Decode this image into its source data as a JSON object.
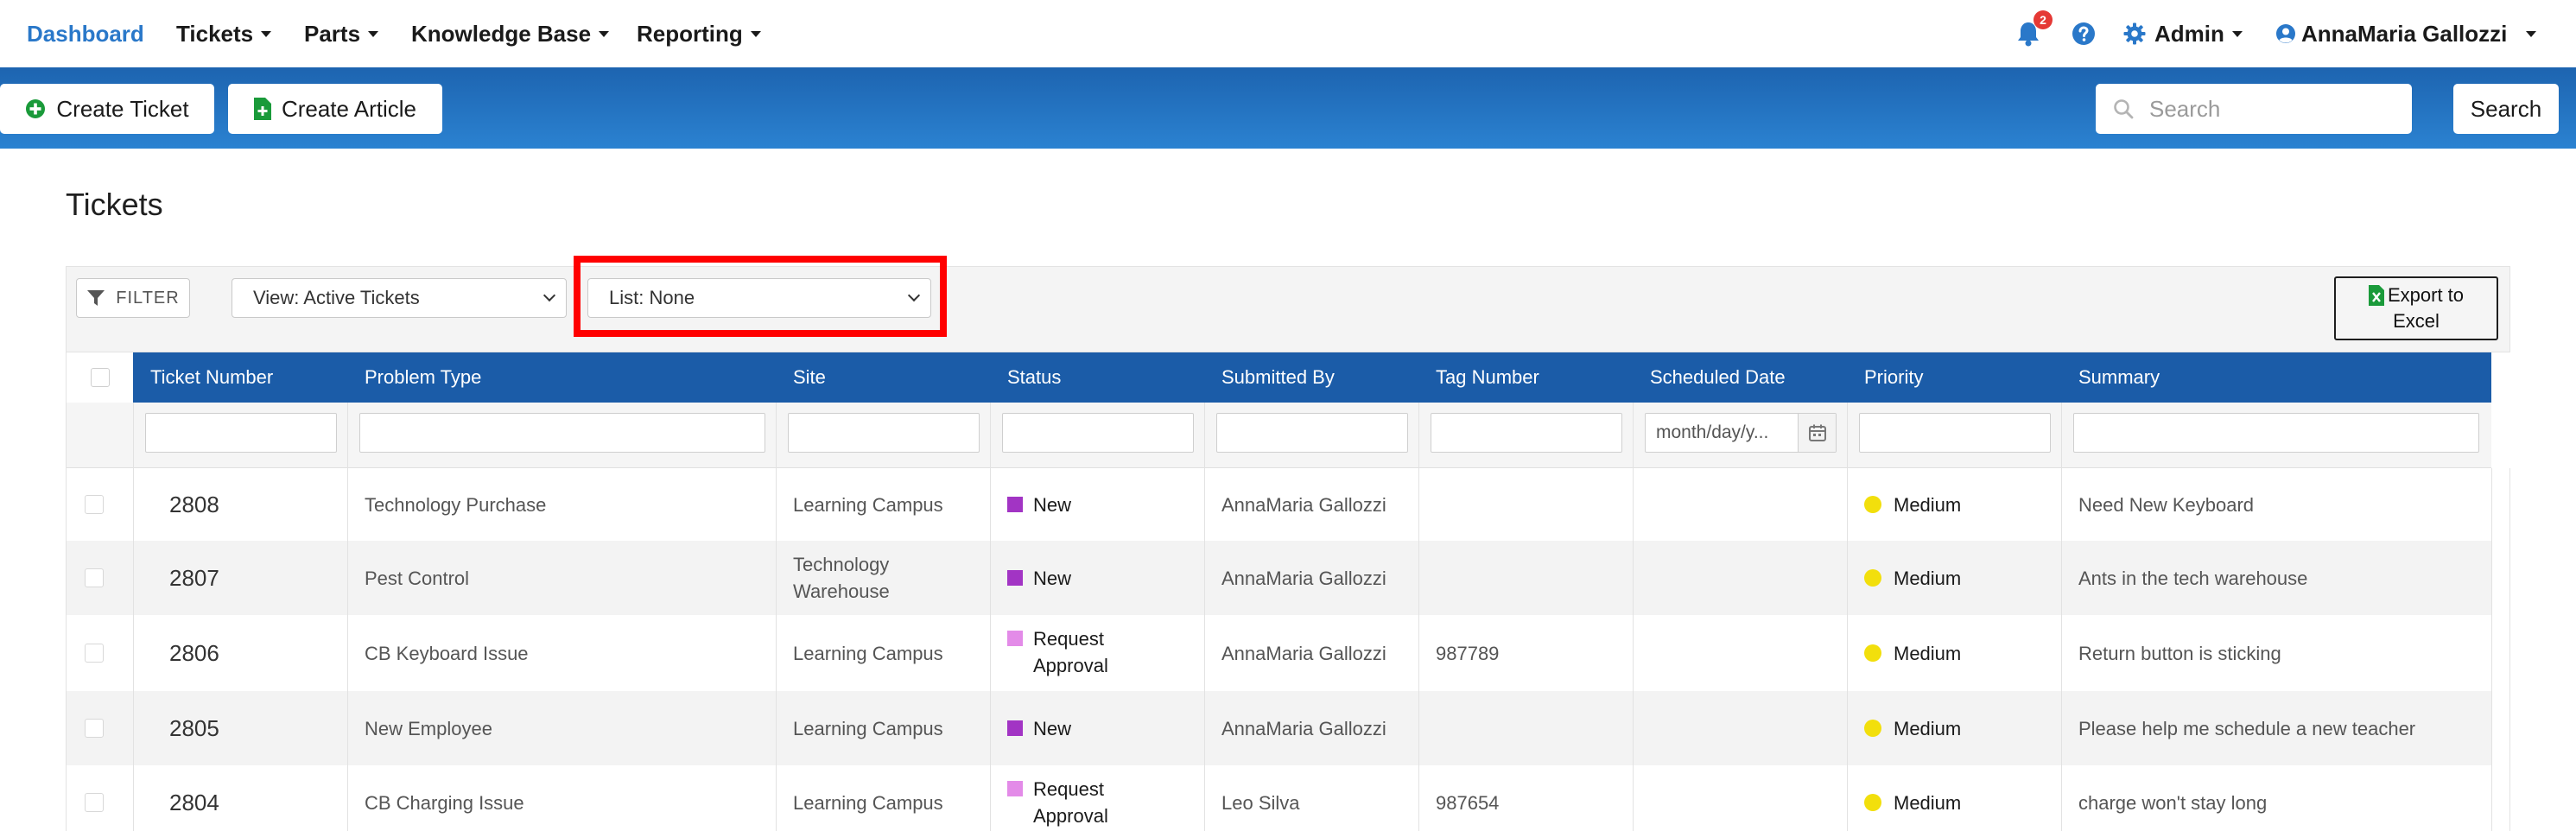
{
  "nav": {
    "brand": "Dashboard",
    "menus": [
      "Tickets",
      "Parts",
      "Knowledge Base",
      "Reporting"
    ],
    "notifications_count": "2",
    "notifications_icon": "bell-icon",
    "help_icon": "question-circle-icon",
    "admin_label": "Admin",
    "user_name": "AnnaMaria Gallozzi"
  },
  "toolbar": {
    "create_ticket": "Create Ticket",
    "create_article": "Create Article",
    "search_placeholder": "Search",
    "search_button": "Search"
  },
  "page": {
    "title": "Tickets"
  },
  "filters": {
    "filter_button": "FILTER",
    "view_select": "View: Active Tickets",
    "list_select": "List: None",
    "export_line1": "Export to",
    "export_line2": "Excel"
  },
  "table": {
    "columns": [
      "Ticket Number",
      "Problem Type",
      "Site",
      "Status",
      "Submitted By",
      "Tag Number",
      "Scheduled Date",
      "Priority",
      "Summary"
    ],
    "date_placeholder": "month/day/y...",
    "rows": [
      {
        "ticket": "2808",
        "problem": "Technology Purchase",
        "site": "Learning Campus",
        "status": "New",
        "submitted_by": "AnnaMaria Gallozzi",
        "tag": "",
        "scheduled": "",
        "priority": "Medium",
        "summary": "Need New Keyboard"
      },
      {
        "ticket": "2807",
        "problem": "Pest Control",
        "site": "Technology Warehouse",
        "status": "New",
        "submitted_by": "AnnaMaria Gallozzi",
        "tag": "",
        "scheduled": "",
        "priority": "Medium",
        "summary": "Ants in the tech warehouse"
      },
      {
        "ticket": "2806",
        "problem": "CB Keyboard Issue",
        "site": "Learning Campus",
        "status": "Request Approval",
        "submitted_by": "AnnaMaria Gallozzi",
        "tag": "987789",
        "scheduled": "",
        "priority": "Medium",
        "summary": "Return button is sticking"
      },
      {
        "ticket": "2805",
        "problem": "New Employee",
        "site": "Learning Campus",
        "status": "New",
        "submitted_by": "AnnaMaria Gallozzi",
        "tag": "",
        "scheduled": "",
        "priority": "Medium",
        "summary": "Please help me schedule a new teacher"
      },
      {
        "ticket": "2804",
        "problem": "CB Charging Issue",
        "site": "Learning Campus",
        "status": "Request Approval",
        "submitted_by": "Leo Silva",
        "tag": "987654",
        "scheduled": "",
        "priority": "Medium",
        "summary": "charge won't stay long"
      }
    ]
  },
  "colors": {
    "brand": "#2a78c9",
    "toolbar_top": "#1d64b0",
    "toolbar_bottom": "#2b82d1",
    "table_header": "#1b5ca8",
    "status_new": "#a234c4",
    "status_request_approval": "#e38be8",
    "priority_medium": "#f2df0c",
    "highlight": "#ff0000",
    "create_icon": "#1a9a3a"
  }
}
